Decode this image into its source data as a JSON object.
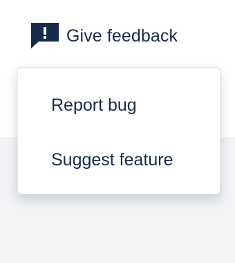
{
  "feedback": {
    "label": "Give feedback",
    "icon": "feedback-bubble-icon",
    "icon_color": "#172b4d"
  },
  "menu": {
    "items": [
      {
        "label": "Report bug"
      },
      {
        "label": "Suggest feature"
      }
    ]
  },
  "colors": {
    "text": "#172b4d",
    "page_background_lower": "#f2f3f5",
    "menu_background": "#ffffff"
  }
}
